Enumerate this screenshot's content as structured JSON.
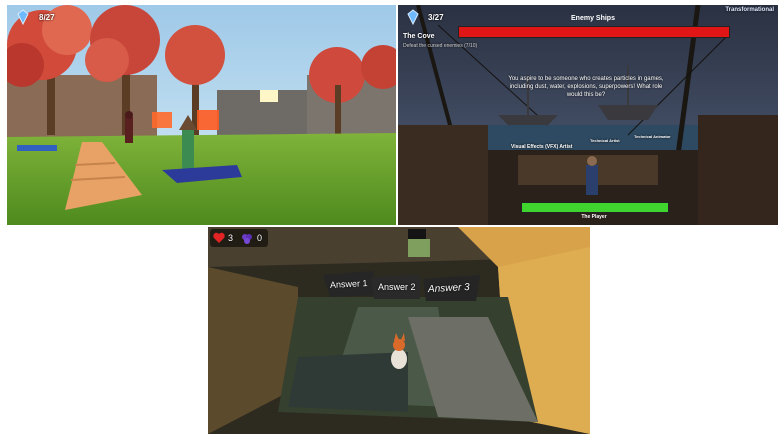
{
  "panel_garden": {
    "gem_count": "8/27"
  },
  "panel_ship": {
    "gem_count": "3/27",
    "level_title": "The Cove",
    "objective": "Defeat the cursed enemies (7/10)",
    "enemy_bar_label": "Enemy Ships",
    "corner_title": "Transformational",
    "question": "You aspire to be someone who creates particles in games, including dust, water, explosions, superpowers! What role would this be?",
    "option_1": "Visual Effects (VFX) Artist",
    "option_2": "Technical Artist",
    "option_3": "Technical Animator",
    "player_bar_label": "The Player",
    "enemy_health": 1.0,
    "player_health": 1.0
  },
  "panel_maze": {
    "hearts": "3",
    "grapes": "0",
    "answer_1": "Answer 1",
    "answer_2": "Answer 2",
    "answer_3": "Answer 3"
  },
  "colors": {
    "enemy_bar": "#e01616",
    "player_bar": "#3fd42e",
    "grass": "#5e9e2a",
    "sky": "#8fc2e4"
  }
}
